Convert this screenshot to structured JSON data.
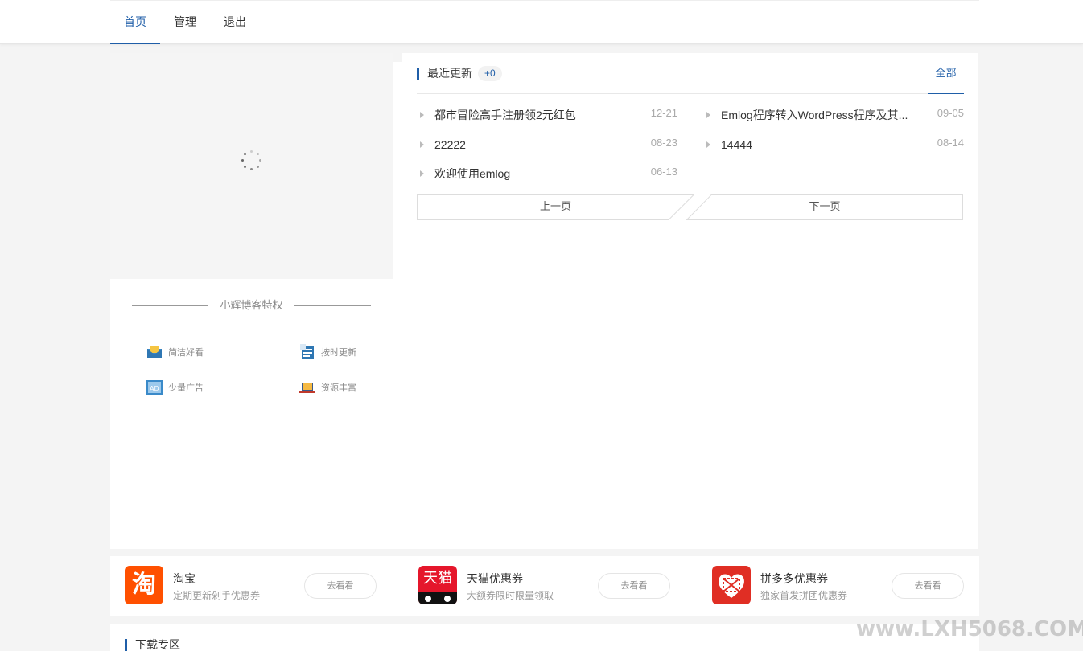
{
  "nav": {
    "items": [
      {
        "label": "首页",
        "active": true
      },
      {
        "label": "管理",
        "active": false
      },
      {
        "label": "退出",
        "active": false
      }
    ]
  },
  "privilege": {
    "title": "小辉博客特权",
    "items": [
      {
        "label": "简洁好看",
        "icon": "envelope-icon"
      },
      {
        "label": "按时更新",
        "icon": "document-icon"
      },
      {
        "label": "少量广告",
        "icon": "ad-icon"
      },
      {
        "label": "资源丰富",
        "icon": "laptop-icon"
      }
    ]
  },
  "recent": {
    "title": "最近更新",
    "badge": "+0",
    "all_label": "全部",
    "posts": [
      {
        "title": "都市冒险高手注册领2元红包",
        "date": "12-21"
      },
      {
        "title": "Emlog程序转入WordPress程序及其...",
        "date": "09-05"
      },
      {
        "title": "22222",
        "date": "08-23"
      },
      {
        "title": "14444",
        "date": "08-14"
      },
      {
        "title": "欢迎使用emlog",
        "date": "06-13"
      }
    ],
    "prev_label": "上一页",
    "next_label": "下一页"
  },
  "coupons": [
    {
      "name": "淘宝",
      "desc": "定期更新剁手优惠券",
      "button": "去看看",
      "logo_text": "淘",
      "color": "#ff5000"
    },
    {
      "name": "天猫优惠券",
      "desc": "大额券限时限量领取",
      "button": "去看看",
      "logo_text": "天猫",
      "color": "#e5162b"
    },
    {
      "name": "拼多多优惠券",
      "desc": "独家首发拼团优惠券",
      "button": "去看看",
      "logo_text": "",
      "color": "#e02e24"
    }
  ],
  "download": {
    "title": "下载专区"
  },
  "watermark": "www.LXH5068.COM",
  "colors": {
    "accent": "#1f5ea8",
    "background": "#f4f4f4"
  }
}
